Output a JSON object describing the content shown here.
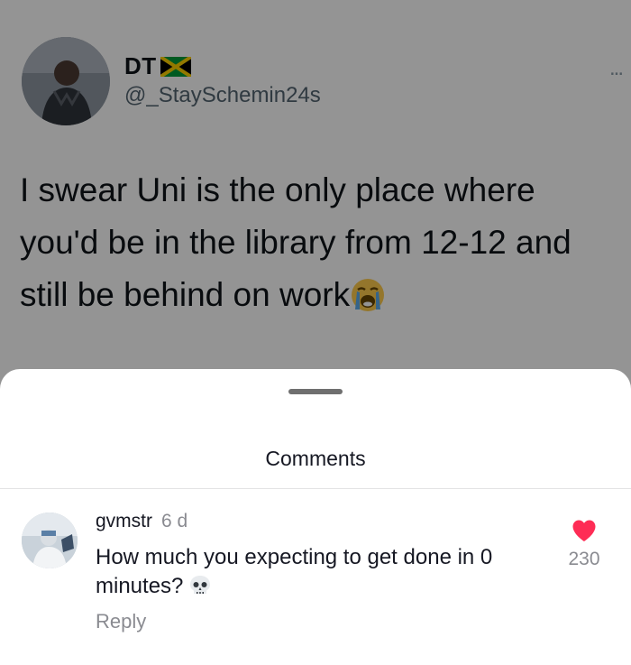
{
  "tweet": {
    "display_name": "DT",
    "flag_icon": "jamaica-flag-icon",
    "handle": "@_StaySchemin24s",
    "more_label": "...",
    "text": "I swear Uni is the only place where you'd be in the library from 12-12 and still be behind on work",
    "text_emoji": "loudly-crying-face-emoji"
  },
  "comments_sheet": {
    "title": "Comments",
    "comments": [
      {
        "username": "gvmstr",
        "time_ago": "6 d",
        "text": "How much you expecting to get done in 0 minutes?",
        "text_emoji": "skull-emoji",
        "like_count": "230",
        "liked": true,
        "reply_label": "Reply"
      }
    ]
  },
  "colors": {
    "like_red": "#fe2c55",
    "overlay": "rgba(0,0,0,0.42)",
    "secondary_text": "#8a8b91"
  }
}
